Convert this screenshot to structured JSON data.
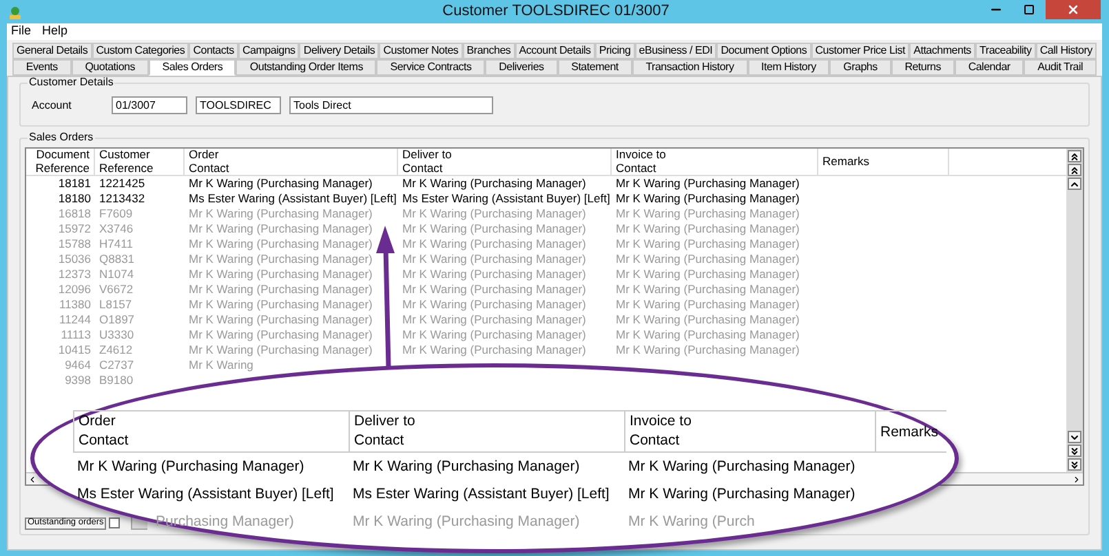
{
  "window": {
    "title": "Customer TOOLSDIREC 01/3007"
  },
  "menu": [
    "File",
    "Help"
  ],
  "tabs_row_1": [
    {
      "label": "General Details",
      "selected": false
    },
    {
      "label": "Custom Categories",
      "selected": false
    },
    {
      "label": "Contacts",
      "selected": false
    },
    {
      "label": "Campaigns",
      "selected": false
    },
    {
      "label": "Delivery Details",
      "selected": false
    },
    {
      "label": "Customer Notes",
      "selected": false
    },
    {
      "label": "Branches",
      "selected": false
    },
    {
      "label": "Account Details",
      "selected": false
    },
    {
      "label": "Pricing",
      "selected": false
    },
    {
      "label": "eBusiness / EDI",
      "selected": false
    },
    {
      "label": "Document Options",
      "selected": false
    },
    {
      "label": "Customer Price List",
      "selected": false
    },
    {
      "label": "Attachments",
      "selected": false
    },
    {
      "label": "Traceability",
      "selected": false
    },
    {
      "label": "Call History",
      "selected": false
    }
  ],
  "tabs_row_2": [
    {
      "label": "Events",
      "selected": false
    },
    {
      "label": "Quotations",
      "selected": false
    },
    {
      "label": "Sales Orders",
      "selected": true
    },
    {
      "label": "Outstanding Order Items",
      "selected": false
    },
    {
      "label": "Service Contracts",
      "selected": false
    },
    {
      "label": "Deliveries",
      "selected": false
    },
    {
      "label": "Statement",
      "selected": false
    },
    {
      "label": "Transaction History",
      "selected": false
    },
    {
      "label": "Item History",
      "selected": false
    },
    {
      "label": "Graphs",
      "selected": false
    },
    {
      "label": "Returns",
      "selected": false
    },
    {
      "label": "Calendar",
      "selected": false
    },
    {
      "label": "Audit Trail",
      "selected": false
    }
  ],
  "customer_details": {
    "title": "Customer Details",
    "account_label": "Account",
    "account": "01/3007",
    "code": "TOOLSDIREC",
    "name": "Tools Direct"
  },
  "sales_orders": {
    "title": "Sales Orders",
    "columns": [
      [
        "Document",
        "Reference"
      ],
      [
        "Customer",
        "Reference"
      ],
      [
        "Order",
        "Contact"
      ],
      [
        "Deliver to",
        "Contact"
      ],
      [
        "Invoice to",
        "Contact"
      ],
      [
        "Remarks"
      ]
    ],
    "rows": [
      {
        "doc": "18181",
        "cust": "1221425",
        "order": "Mr K Waring (Purchasing Manager)",
        "deliver": "Mr K Waring (Purchasing Manager)",
        "invoice": "Mr K Waring (Purchasing Manager)",
        "greyed": false
      },
      {
        "doc": "18180",
        "cust": "1213432",
        "order": "Ms Ester Waring (Assistant Buyer) [Left]",
        "deliver": "Ms Ester Waring (Assistant Buyer) [Left]",
        "invoice": "Mr K Waring (Purchasing Manager)",
        "greyed": false
      },
      {
        "doc": "16818",
        "cust": "F7609",
        "order": "Mr K Waring (Purchasing Manager)",
        "deliver": "Mr K Waring (Purchasing Manager)",
        "invoice": "Mr K Waring (Purchasing Manager)",
        "greyed": true
      },
      {
        "doc": "15972",
        "cust": "X3746",
        "order": "Mr K Waring (Purchasing Manager)",
        "deliver": "Mr K Waring (Purchasing Manager)",
        "invoice": "Mr K Waring (Purchasing Manager)",
        "greyed": true
      },
      {
        "doc": "15788",
        "cust": "H7411",
        "order": "Mr K Waring (Purchasing Manager)",
        "deliver": "Mr K Waring (Purchasing Manager)",
        "invoice": "Mr K Waring (Purchasing Manager)",
        "greyed": true
      },
      {
        "doc": "15036",
        "cust": "Q8831",
        "order": "Mr K Waring (Purchasing Manager)",
        "deliver": "Mr K Waring (Purchasing Manager)",
        "invoice": "Mr K Waring (Purchasing Manager)",
        "greyed": true
      },
      {
        "doc": "12373",
        "cust": "N1074",
        "order": "Mr K Waring (Purchasing Manager)",
        "deliver": "Mr K Waring (Purchasing Manager)",
        "invoice": "Mr K Waring (Purchasing Manager)",
        "greyed": true
      },
      {
        "doc": "12096",
        "cust": "V6672",
        "order": "Mr K Waring (Purchasing Manager)",
        "deliver": "Mr K Waring (Purchasing Manager)",
        "invoice": "Mr K Waring (Purchasing Manager)",
        "greyed": true
      },
      {
        "doc": "11380",
        "cust": "L8157",
        "order": "Mr K Waring (Purchasing Manager)",
        "deliver": "Mr K Waring (Purchasing Manager)",
        "invoice": "Mr K Waring (Purchasing Manager)",
        "greyed": true
      },
      {
        "doc": "11244",
        "cust": "O1897",
        "order": "Mr K Waring (Purchasing Manager)",
        "deliver": "Mr K Waring (Purchasing Manager)",
        "invoice": "Mr K Waring (Purchasing Manager)",
        "greyed": true
      },
      {
        "doc": "11113",
        "cust": "U3330",
        "order": "Mr K Waring (Purchasing Manager)",
        "deliver": "Mr K Waring (Purchasing Manager)",
        "invoice": "Mr K Waring (Purchasing Manager)",
        "greyed": true
      },
      {
        "doc": "10415",
        "cust": "Z4612",
        "order": "Mr K Waring (Purchasing Manager)",
        "deliver": "Mr K Waring (Purchasing Manager)",
        "invoice": "Mr K Waring (Purchasing Manager)",
        "greyed": true
      },
      {
        "doc": "9464",
        "cust": "C2737",
        "order": "Mr K Waring",
        "greyed": true
      },
      {
        "doc": "9398",
        "cust": "B9180",
        "greyed": true
      }
    ]
  },
  "outstanding_orders": {
    "label": "Outstanding orders",
    "checked": false
  },
  "callout": {
    "columns": [
      [
        "Order",
        "Contact"
      ],
      [
        "Deliver to",
        "Contact"
      ],
      [
        "Invoice to",
        "Contact"
      ],
      [
        "Remarks"
      ]
    ],
    "rows": [
      {
        "order": "Mr K Waring (Purchasing Manager)",
        "deliver": "Mr K Waring (Purchasing Manager)",
        "invoice": "Mr K Waring (Purchasing Manager)",
        "greyed": false
      },
      {
        "order": "Ms Ester Waring (Assistant Buyer) [Left]",
        "deliver": "Ms Ester Waring (Assistant Buyer) [Left]",
        "invoice": "Mr K Waring (Purchasing Manager)",
        "greyed": false
      },
      {
        "order": "Purchasing Manager)",
        "deliver": "Mr K Waring (Purchasing Manager)",
        "invoice": "Mr K Waring (Purch",
        "greyed": true
      }
    ]
  }
}
